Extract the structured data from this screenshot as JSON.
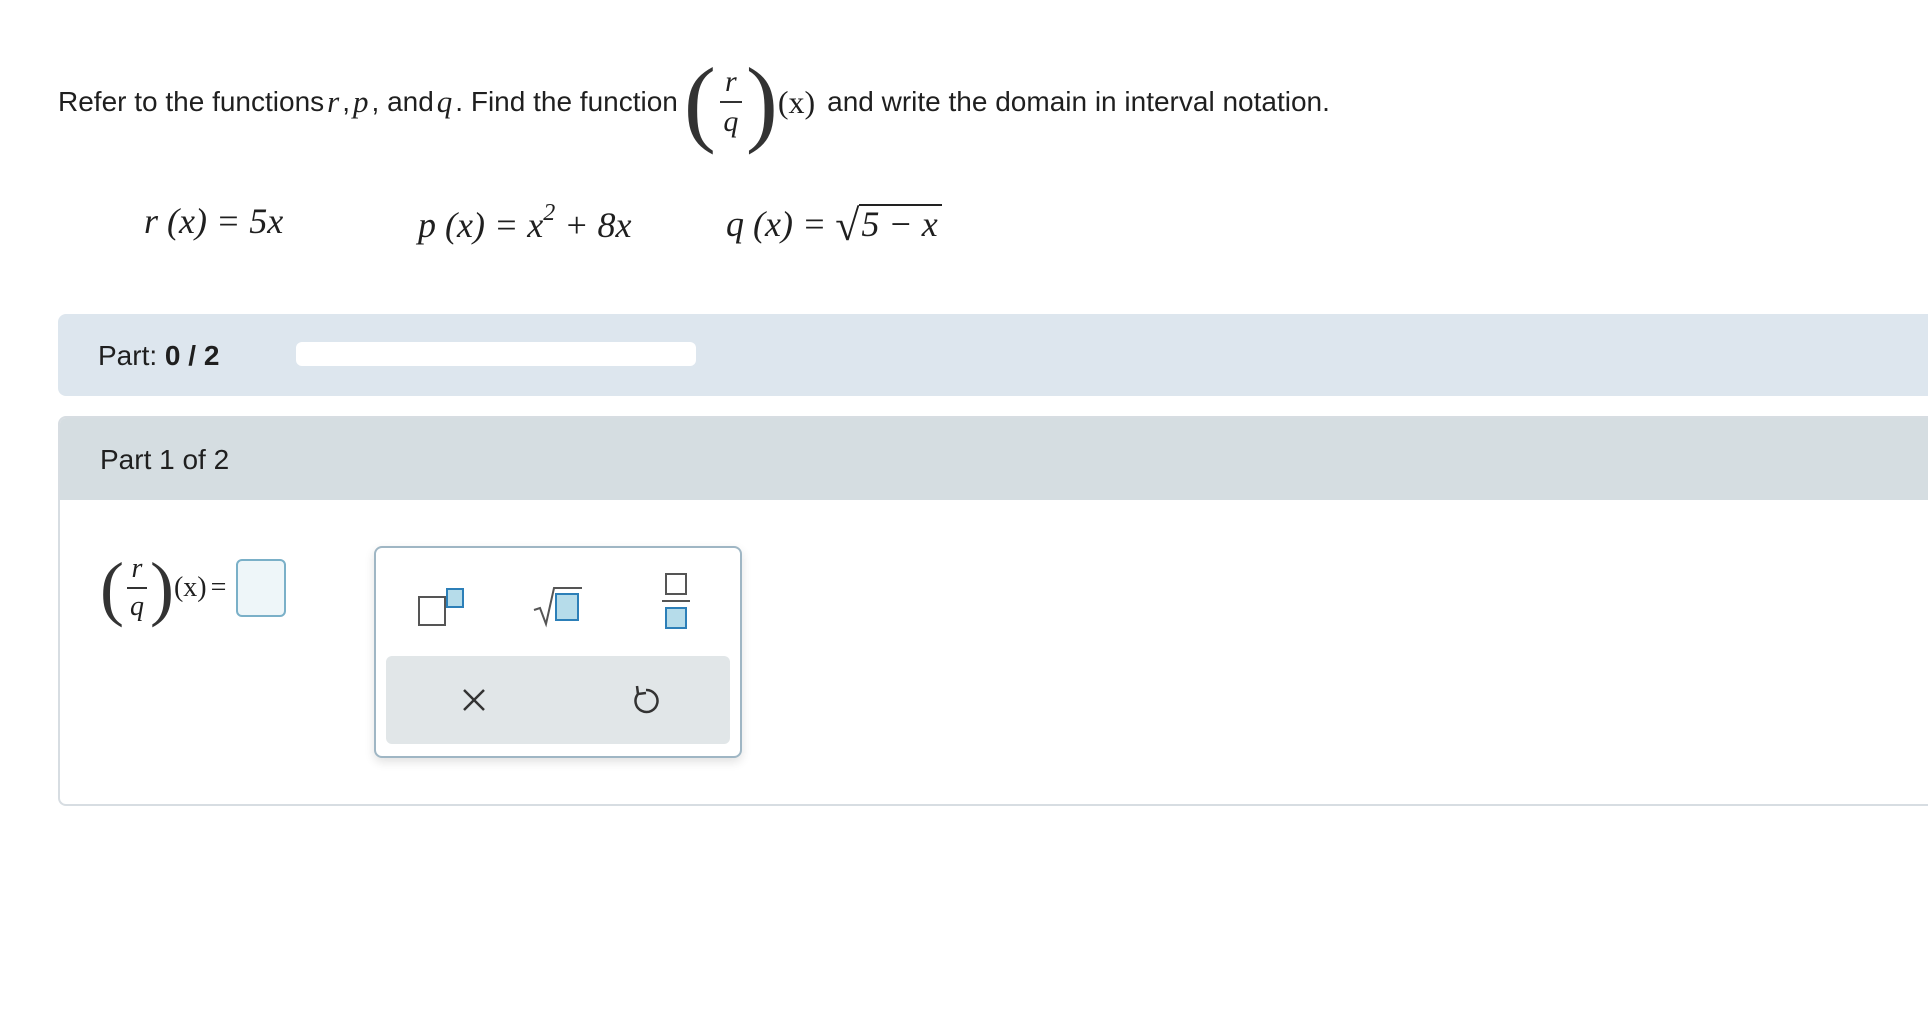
{
  "question": {
    "prefix": "Refer to the functions",
    "var_r": "r",
    "comma1": ",",
    "var_p": "p",
    "comma_and": ", and",
    "var_q": "q",
    "mid": ". Find the function",
    "frac_num": "r",
    "frac_den": "q",
    "arg": "(x)",
    "suffix": "and write the domain in interval notation."
  },
  "functions": {
    "r": {
      "lhs": "r (x) = 5x"
    },
    "p": {
      "lhs": "p (x) = x",
      "exp": "2",
      "rest": " + 8x"
    },
    "q": {
      "lhs": "q (x) = ",
      "radicand": "5 − x"
    }
  },
  "progress": {
    "label": "Part:",
    "value_text": "0 / 2",
    "fraction": 0
  },
  "part": {
    "title": "Part 1 of 2",
    "answer_num": "r",
    "answer_den": "q",
    "answer_arg": "(x)",
    "equals": "="
  },
  "palette": {
    "superscript_icon": "superscript-icon",
    "sqrt_icon": "sqrt-icon",
    "fraction_icon": "fraction-icon",
    "clear_icon": "clear-icon",
    "clear_glyph": "×",
    "undo_icon": "undo-icon"
  }
}
